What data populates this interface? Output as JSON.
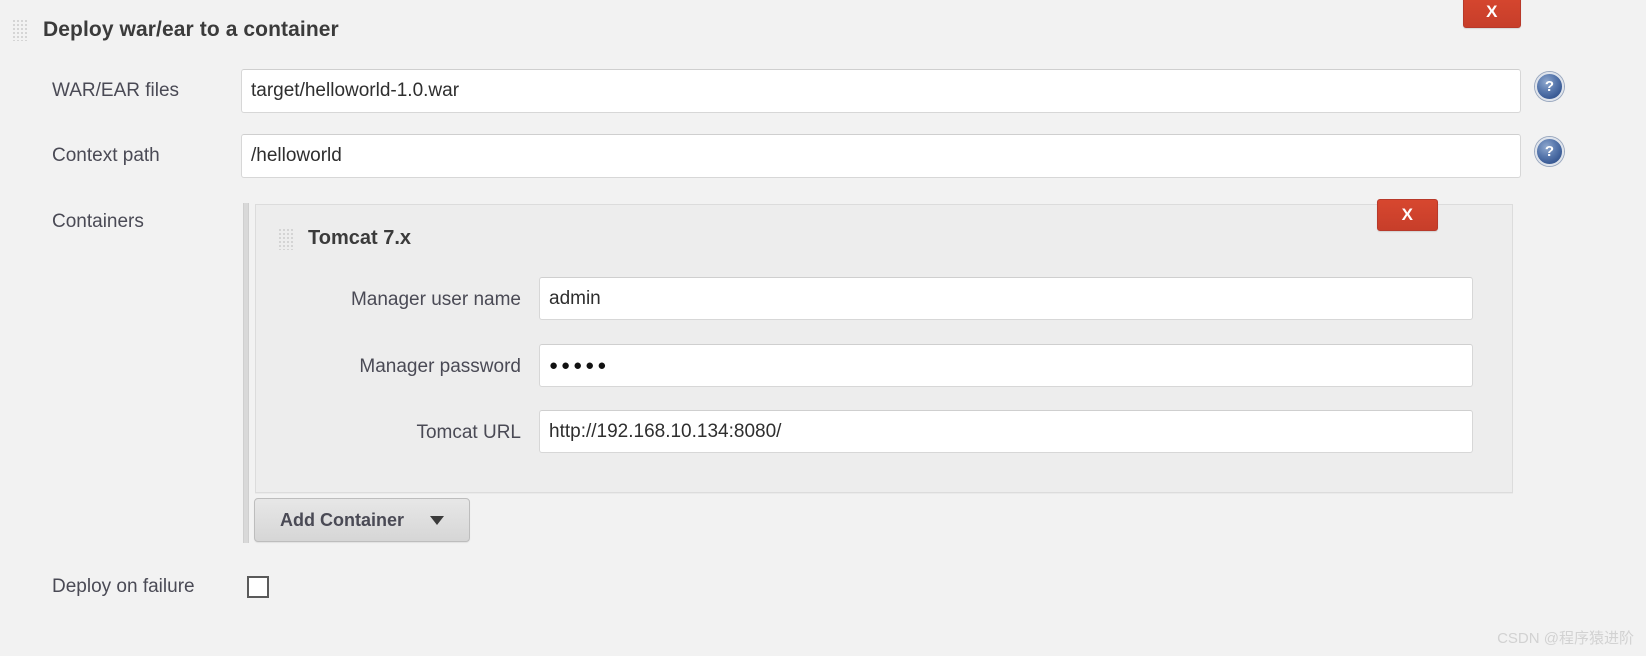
{
  "form": {
    "title": "Deploy war/ear to a container",
    "drag_handle_icon": "grip-dots-icon",
    "delete_icon_label": "X",
    "help_icon_label": "?",
    "fields": [
      {
        "label": "WAR/EAR files",
        "value": "target/helloworld-1.0.war",
        "help": "?"
      },
      {
        "label": "Context path",
        "value": "/helloworld",
        "help": "?"
      }
    ],
    "containers_label": "Containers",
    "container": {
      "title": "Tomcat 7.x",
      "delete_icon_label": "X",
      "fields": [
        {
          "label": "Manager user name",
          "value": "admin",
          "type": "text"
        },
        {
          "label": "Manager password",
          "value": "●●●●●",
          "type": "password"
        },
        {
          "label": "Tomcat URL",
          "value": "http://192.168.10.134:8080/",
          "type": "text"
        }
      ]
    },
    "add_container_button": "Add Container",
    "add_container_caret_icon": "chevron-down-icon",
    "deploy_on_failure": {
      "label": "Deploy on failure",
      "checked": false
    }
  },
  "watermark": "CSDN @程序猿进阶",
  "colors": {
    "background": "#f2f2f2",
    "panel": "#ededed",
    "danger": "#d4412c",
    "help_blue": "#3c5d97",
    "field_bg": "#ffffff",
    "text": "#4a4a55"
  }
}
